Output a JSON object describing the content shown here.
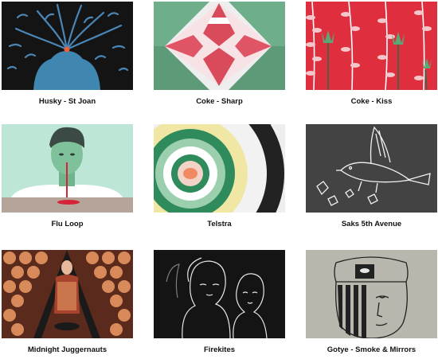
{
  "gallery": {
    "items": [
      {
        "title": "Husky - St Joan",
        "thumb_icon": "husky-st-joan-thumbnail"
      },
      {
        "title": "Coke - Sharp",
        "thumb_icon": "coke-sharp-thumbnail"
      },
      {
        "title": "Coke - Kiss",
        "thumb_icon": "coke-kiss-thumbnail"
      },
      {
        "title": "Flu Loop",
        "thumb_icon": "flu-loop-thumbnail"
      },
      {
        "title": "Telstra",
        "thumb_icon": "telstra-thumbnail"
      },
      {
        "title": "Saks 5th Avenue",
        "thumb_icon": "saks-5th-avenue-thumbnail"
      },
      {
        "title": "Midnight Juggernauts",
        "thumb_icon": "midnight-juggernauts-thumbnail"
      },
      {
        "title": "Firekites",
        "thumb_icon": "firekites-thumbnail"
      },
      {
        "title": "Gotye - Smoke & Mirrors",
        "thumb_icon": "gotye-smoke-mirrors-thumbnail"
      }
    ]
  },
  "colors": {
    "caption": "#111111",
    "background": "#ffffff"
  }
}
